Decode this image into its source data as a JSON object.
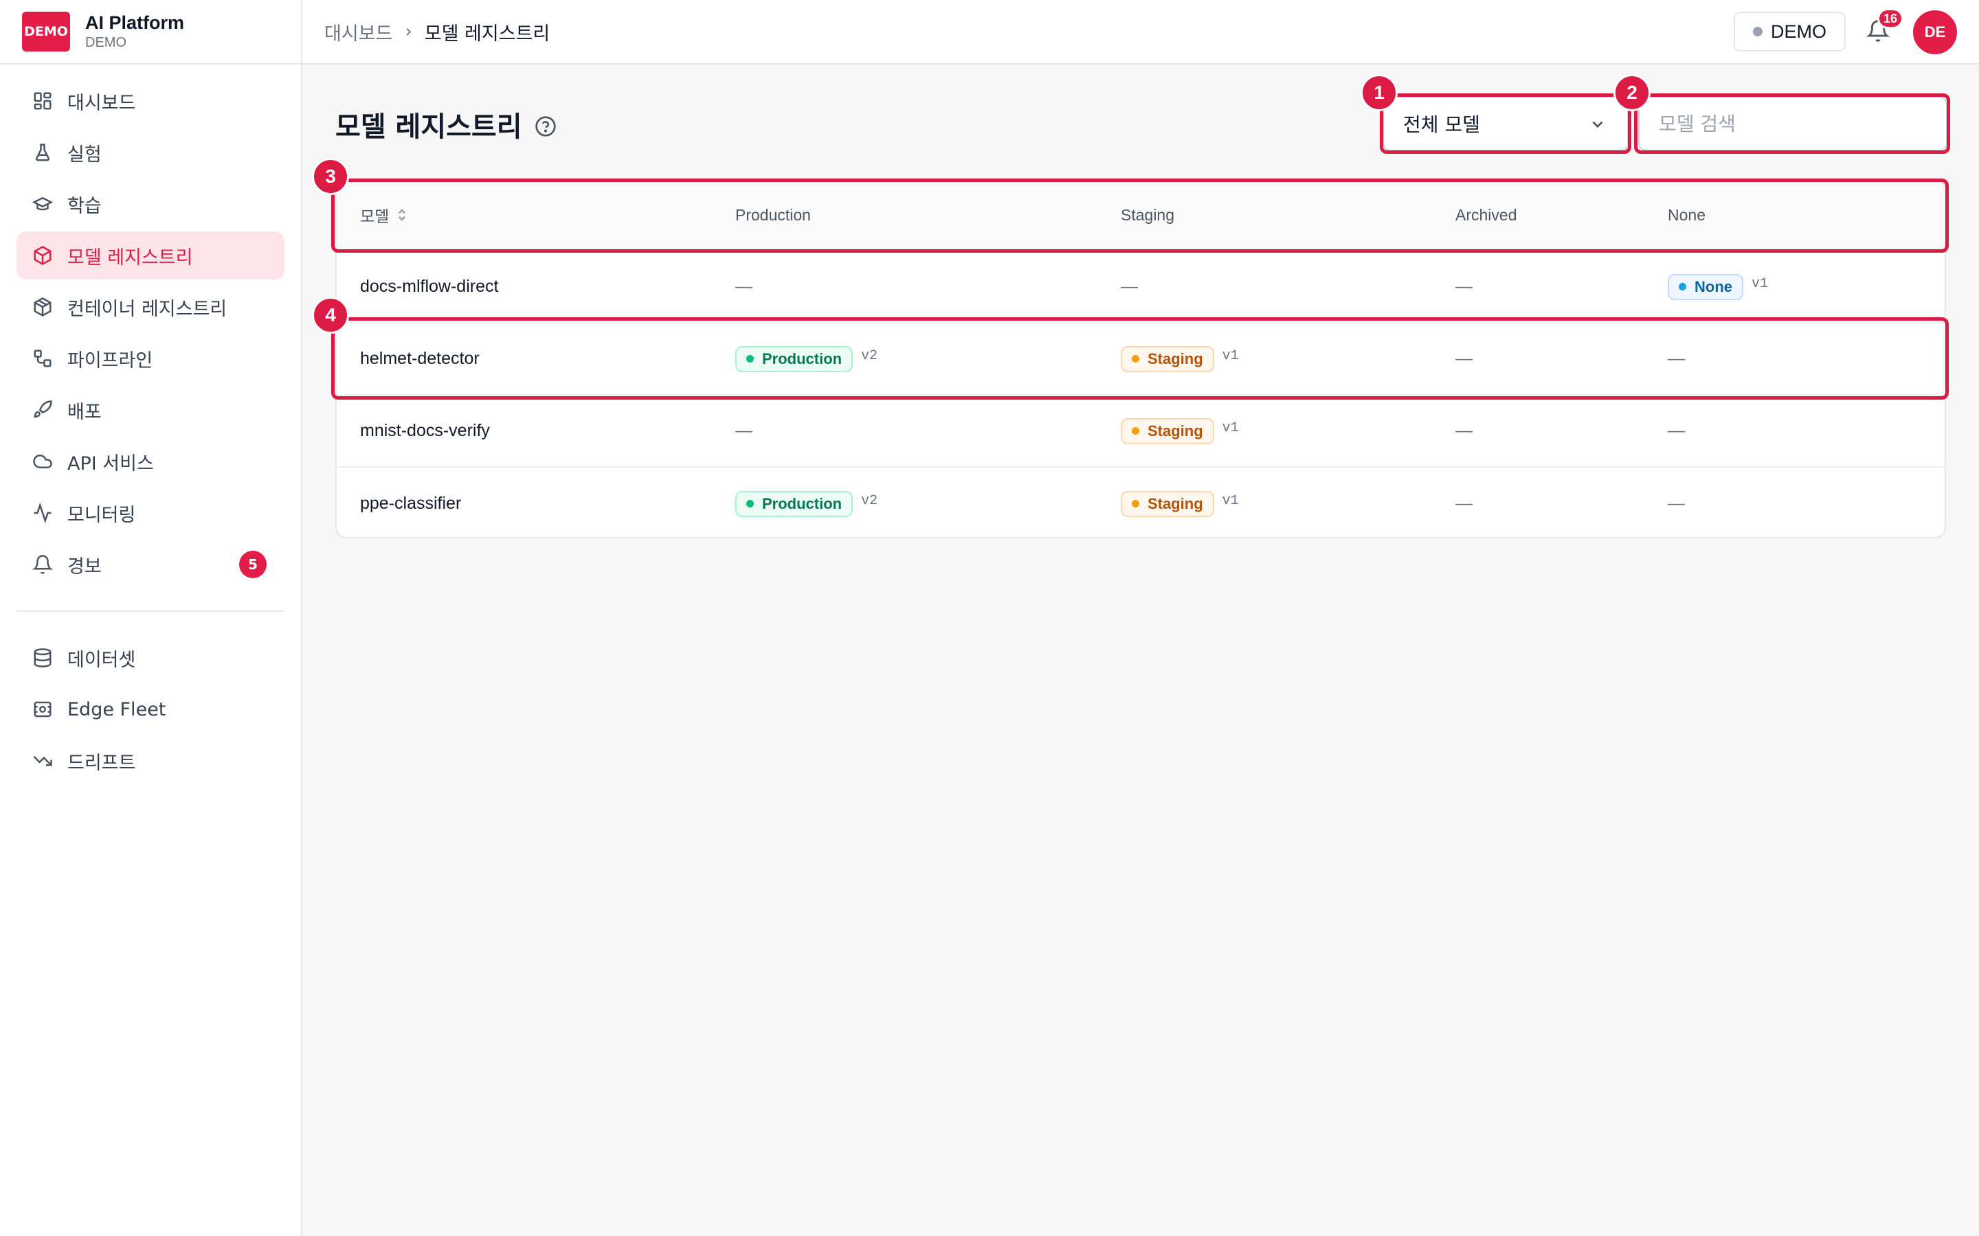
{
  "brand": {
    "logo_text": "DEMO",
    "title": "AI Platform",
    "subtitle": "DEMO"
  },
  "sidebar": {
    "items": [
      {
        "label": "대시보드",
        "icon": "dashboard-icon",
        "active": false
      },
      {
        "label": "실험",
        "icon": "flask-icon",
        "active": false
      },
      {
        "label": "학습",
        "icon": "graduation-cap-icon",
        "active": false
      },
      {
        "label": "모델 레지스트리",
        "icon": "cube-icon",
        "active": true
      },
      {
        "label": "컨테이너 레지스트리",
        "icon": "box-icon",
        "active": false
      },
      {
        "label": "파이프라인",
        "icon": "pipeline-icon",
        "active": false
      },
      {
        "label": "배포",
        "icon": "rocket-icon",
        "active": false
      },
      {
        "label": "API 서비스",
        "icon": "cloud-icon",
        "active": false
      },
      {
        "label": "모니터링",
        "icon": "activity-icon",
        "active": false
      },
      {
        "label": "경보",
        "icon": "bell-icon",
        "active": false,
        "badge": "5"
      }
    ],
    "secondary_items": [
      {
        "label": "데이터셋",
        "icon": "database-icon"
      },
      {
        "label": "Edge Fleet",
        "icon": "edge-device-icon"
      },
      {
        "label": "드리프트",
        "icon": "trending-down-icon"
      }
    ]
  },
  "topbar": {
    "breadcrumb_parent": "대시보드",
    "breadcrumb_current": "모델 레지스트리",
    "env_label": "DEMO",
    "notification_count": "16",
    "avatar_initials": "DE"
  },
  "main": {
    "title": "모델 레지스트리",
    "filter_select": {
      "value": "전체 모델"
    },
    "search": {
      "placeholder": "모델 검색",
      "value": ""
    },
    "table": {
      "columns": [
        "모델",
        "Production",
        "Staging",
        "Archived",
        "None"
      ],
      "rows": [
        {
          "name": "docs-mlflow-direct",
          "production": null,
          "staging": null,
          "archived": null,
          "none": {
            "label": "None",
            "version": "v1"
          }
        },
        {
          "name": "helmet-detector",
          "production": {
            "label": "Production",
            "version": "v2"
          },
          "staging": {
            "label": "Staging",
            "version": "v1"
          },
          "archived": null,
          "none": null
        },
        {
          "name": "mnist-docs-verify",
          "production": null,
          "staging": {
            "label": "Staging",
            "version": "v1"
          },
          "archived": null,
          "none": null
        },
        {
          "name": "ppe-classifier",
          "production": {
            "label": "Production",
            "version": "v2"
          },
          "staging": {
            "label": "Staging",
            "version": "v1"
          },
          "archived": null,
          "none": null
        }
      ],
      "empty_placeholder": "—"
    }
  },
  "annotations": [
    "1",
    "2",
    "3",
    "4"
  ],
  "colors": {
    "accent": "#e11d48",
    "highlight": "#dc1b45"
  }
}
